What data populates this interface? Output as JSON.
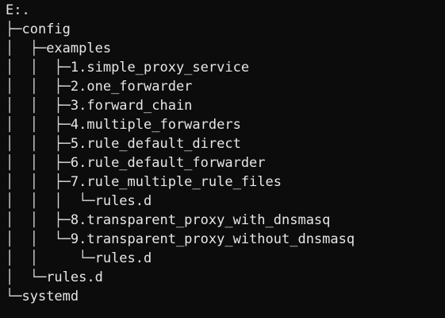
{
  "terminal": {
    "lines": [
      {
        "prefix": "",
        "name": "E:."
      },
      {
        "prefix": "├─",
        "name": "config"
      },
      {
        "prefix": "│  ├─",
        "name": "examples"
      },
      {
        "prefix": "│  │  ├─",
        "name": "1.simple_proxy_service"
      },
      {
        "prefix": "│  │  ├─",
        "name": "2.one_forwarder"
      },
      {
        "prefix": "│  │  ├─",
        "name": "3.forward_chain"
      },
      {
        "prefix": "│  │  ├─",
        "name": "4.multiple_forwarders"
      },
      {
        "prefix": "│  │  ├─",
        "name": "5.rule_default_direct"
      },
      {
        "prefix": "│  │  ├─",
        "name": "6.rule_default_forwarder"
      },
      {
        "prefix": "│  │  ├─",
        "name": "7.rule_multiple_rule_files"
      },
      {
        "prefix": "│  │  │  └─",
        "name": "rules.d"
      },
      {
        "prefix": "│  │  ├─",
        "name": "8.transparent_proxy_with_dnsmasq"
      },
      {
        "prefix": "│  │  └─",
        "name": "9.transparent_proxy_without_dnsmasq"
      },
      {
        "prefix": "│  │     └─",
        "name": "rules.d"
      },
      {
        "prefix": "│  └─",
        "name": "rules.d"
      },
      {
        "prefix": "└─",
        "name": "systemd"
      }
    ]
  }
}
